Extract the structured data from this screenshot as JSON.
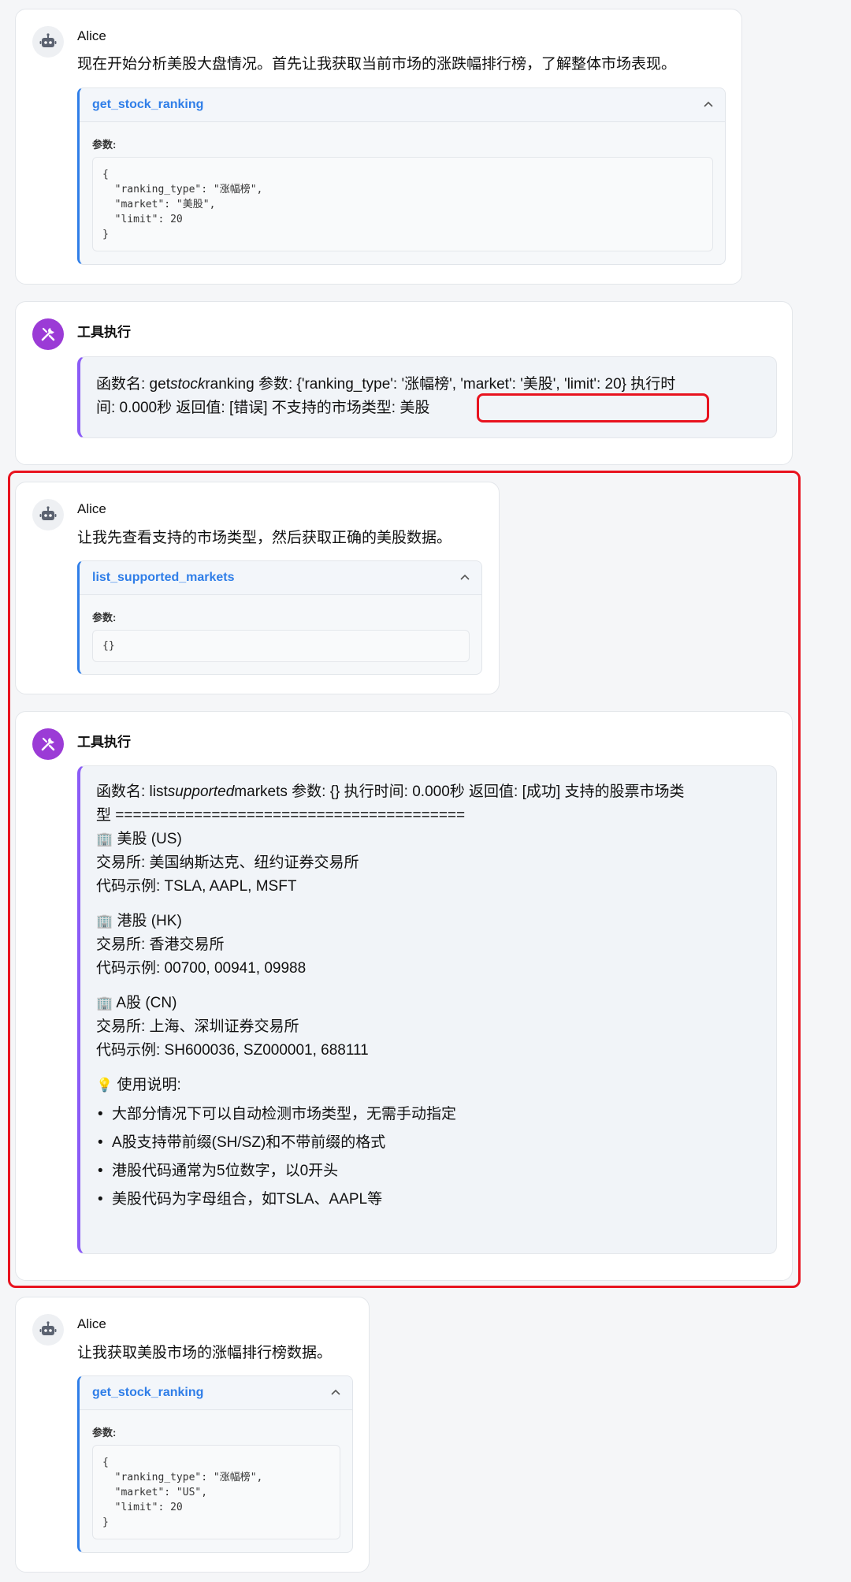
{
  "messages": [
    {
      "sender": "Alice",
      "text": "现在开始分析美股大盘情况。首先让我获取当前市场的涨跌幅排行榜，了解整体市场表现。",
      "fn_name": "get_stock_ranking",
      "params_label": "参数:",
      "code": "{\n  \"ranking_type\": \"涨幅榜\",\n  \"market\": \"美股\",\n  \"limit\": 20\n}"
    },
    {
      "sender": "工具执行",
      "line1_a": "函数名: get",
      "line1_i": "stock",
      "line1_b": "ranking 参数: {'ranking_type': '涨幅榜', 'market': '美股', 'limit': 20} 执行时",
      "line2": "间: 0.000秒 返回值: [错误] 不支持的市场类型: 美股"
    },
    {
      "sender": "Alice",
      "text": "让我先查看支持的市场类型，然后获取正确的美股数据。",
      "fn_name": "list_supported_markets",
      "params_label": "参数:",
      "code": "{}"
    },
    {
      "sender": "工具执行",
      "line1_a": "函数名: list",
      "line1_i": "supported",
      "line1_b": "markets 参数: {} 执行时间: 0.000秒 返回值: [成功] 支持的股票市场类",
      "line2": "型 ========================================",
      "us_title": "美股 (US)",
      "us_exchange": "交易所: 美国纳斯达克、纽约证券交易所",
      "us_codes": "代码示例: TSLA, AAPL, MSFT",
      "hk_title": "港股 (HK)",
      "hk_exchange": "交易所: 香港交易所",
      "hk_codes": "代码示例: 00700, 00941, 09988",
      "cn_title": "A股 (CN)",
      "cn_exchange": "交易所: 上海、深圳证券交易所",
      "cn_codes": "代码示例: SH600036, SZ000001, 688111",
      "notes_title": "使用说明:",
      "notes": [
        "大部分情况下可以自动检测市场类型，无需手动指定",
        "A股支持带前缀(SH/SZ)和不带前缀的格式",
        "港股代码通常为5位数字，以0开头",
        "美股代码为字母组合，如TSLA、AAPL等"
      ]
    },
    {
      "sender": "Alice",
      "text": "让我获取美股市场的涨幅排行榜数据。",
      "fn_name": "get_stock_ranking",
      "params_label": "参数:",
      "code": "{\n  \"ranking_type\": \"涨幅榜\",\n  \"market\": \"US\",\n  \"limit\": 20\n}"
    }
  ],
  "icons": {
    "bot": "robot-icon",
    "tool": "tools-icon",
    "market": "building-icon",
    "tip": "lightbulb-icon",
    "collapse": "chevron-up-icon"
  },
  "colors": {
    "accent_blue": "#2f7ee8",
    "tool_purple": "#9b3bd6",
    "result_border": "#8b5cf6",
    "highlight_red": "#e8131f"
  }
}
